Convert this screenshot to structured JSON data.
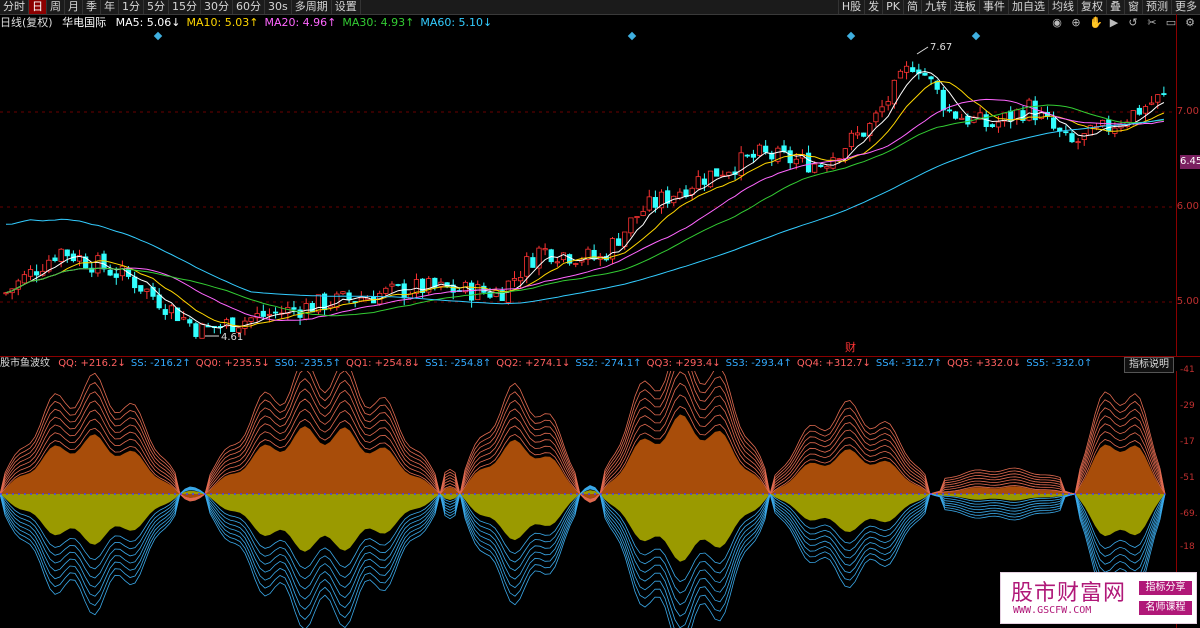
{
  "toolbar": {
    "left": [
      "分时",
      "日",
      "周",
      "月",
      "季",
      "年",
      "1分",
      "5分",
      "15分",
      "30分",
      "60分",
      "30s",
      "多周期",
      "设置"
    ],
    "active": "日",
    "right": [
      "H股",
      "发",
      "PK",
      "简",
      "九转",
      "连板",
      "事件",
      "加自选",
      "均线",
      "复权",
      "叠",
      "窗",
      "预测",
      "更多"
    ]
  },
  "ma_line": {
    "title": "日线(复权)",
    "stock": "华电国际",
    "items": [
      {
        "label": "MA5: 5.06↓",
        "color": "#ffffff"
      },
      {
        "label": "MA10: 5.03↑",
        "color": "#ffd700"
      },
      {
        "label": "MA20: 4.96↑",
        "color": "#ff66ff"
      },
      {
        "label": "MA30: 4.93↑",
        "color": "#33cc33"
      },
      {
        "label": "MA60: 5.10↓",
        "color": "#33ccff"
      }
    ]
  },
  "price_axis": {
    "labels": [
      {
        "text": "7.00",
        "price": 7.0
      },
      {
        "text": "6.00",
        "price": 6.0
      },
      {
        "text": "5.00",
        "price": 5.0
      }
    ],
    "current_tag": "6.45"
  },
  "price_annotations": {
    "high": "7.67",
    "low": "4.61",
    "event": "财"
  },
  "indicator_bar": {
    "name": "股市鱼波纹",
    "items": [
      {
        "label": "QQ: +216.2↓",
        "color": "#ff6060"
      },
      {
        "label": "SS: -216.2↑",
        "color": "#33aaff"
      },
      {
        "label": "QQ0: +235.5↓",
        "color": "#ff6060"
      },
      {
        "label": "SS0: -235.5↑",
        "color": "#33aaff"
      },
      {
        "label": "QQ1: +254.8↓",
        "color": "#ff6060"
      },
      {
        "label": "SS1: -254.8↑",
        "color": "#33aaff"
      },
      {
        "label": "QQ2: +274.1↓",
        "color": "#ff6060"
      },
      {
        "label": "SS2: -274.1↑",
        "color": "#33aaff"
      },
      {
        "label": "QQ3: +293.4↓",
        "color": "#ff6060"
      },
      {
        "label": "SS3: -293.4↑",
        "color": "#33aaff"
      },
      {
        "label": "QQ4: +312.7↓",
        "color": "#ff6060"
      },
      {
        "label": "SS4: -312.7↑",
        "color": "#33aaff"
      },
      {
        "label": "QQ5: +332.0↓",
        "color": "#ff6060"
      },
      {
        "label": "SS5: -332.0↑",
        "color": "#33aaff"
      }
    ],
    "help": "指标说明"
  },
  "indicator_axis": {
    "labels": [
      {
        "text": "-41",
        "value": 410
      },
      {
        "text": "-29",
        "value": 290
      },
      {
        "text": "-17",
        "value": 170
      },
      {
        "text": "-51",
        "value": 50
      },
      {
        "text": "-69.",
        "value": -69
      },
      {
        "text": "-18",
        "value": -180
      }
    ]
  },
  "watermark": {
    "title": "股市财富网",
    "url": "WWW.GSCFW.COM",
    "tag1": "指标分享",
    "tag2": "名师课程"
  },
  "colors": {
    "up": "#ff3333",
    "down": "#33ffff",
    "accent": "#8b0000"
  }
}
